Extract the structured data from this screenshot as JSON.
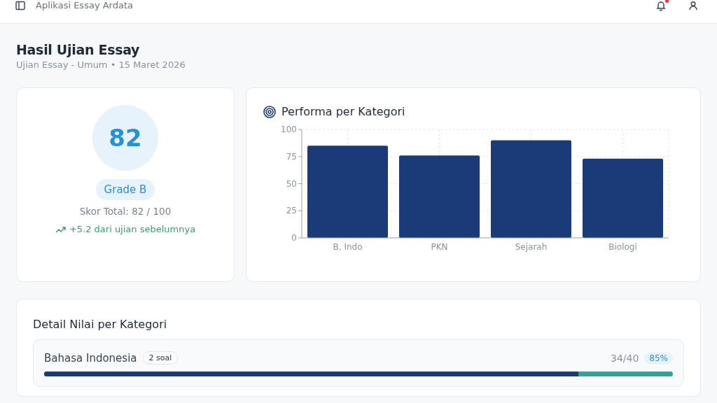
{
  "app_bar": {
    "title": "Aplikasi Essay Ardata",
    "notification": true
  },
  "header": {
    "title": "Hasil Ujian Essay",
    "subtitle": "Ujian Essay - Umum • 15 Maret 2026"
  },
  "score_card": {
    "score": "82",
    "grade": "Grade B",
    "total": "Skor Total: 82 / 100",
    "trend": "+5.2 dari ujian sebelumnya"
  },
  "performance": {
    "title": "Performa per Kategori",
    "chart_data": {
      "type": "bar",
      "categories": [
        "B. Indo",
        "PKN",
        "Sejarah",
        "Biologi"
      ],
      "series": [
        {
          "color": "#1b3a78",
          "values": [
            85,
            76,
            90,
            73
          ]
        }
      ],
      "ylim": [
        0,
        100
      ],
      "yticks": [
        0,
        25,
        50,
        75,
        100
      ],
      "grid": true
    }
  },
  "detail": {
    "title": "Detail Nilai per Kategori",
    "items": [
      {
        "name": "Bahasa Indonesia",
        "count": "2 soal",
        "score": "34/40",
        "percent": "85%",
        "level": 0.85
      }
    ]
  }
}
